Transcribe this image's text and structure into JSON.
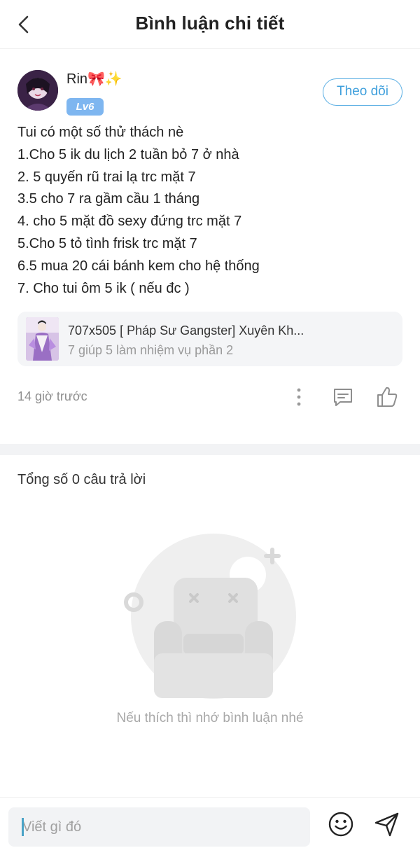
{
  "header": {
    "title": "Bình luận chi tiết",
    "back_icon": "chevron-left-icon"
  },
  "comment": {
    "user": {
      "name": "Rin🎀✨",
      "level": "Lv6"
    },
    "follow_label": "Theo dõi",
    "lines": [
      "Tui có một số thử thách nè",
      "1.Cho 5 ik du lịch 2 tuần bỏ 7 ở nhà",
      "2. 5 quyến rũ trai lạ trc mặt 7",
      "3.5 cho 7 ra gầm cầu 1 tháng",
      "4. cho 5 mặt đồ sexy đứng trc mặt 7",
      "5.Cho 5 tỏ tình frisk trc mặt 7",
      "6.5 mua 20 cái bánh kem cho hệ thống",
      "7. Cho tui ôm 5 ik ( nếu đc )"
    ],
    "novel": {
      "title": "707x505 [ Pháp Sư Gangster] Xuyên Kh...",
      "subtitle": "7 giúp 5 làm nhiệm vụ phần 2"
    },
    "time": "14 giờ trước",
    "actions": [
      "more-icon",
      "reply-icon",
      "like-icon"
    ]
  },
  "replies": {
    "count_label": "Tổng số 0 câu trả lời",
    "empty_text": "Nếu thích thì nhớ bình luận nhé"
  },
  "input": {
    "placeholder": "Viết gì đó",
    "emoji_icon": "emoji-icon",
    "send_icon": "send-icon"
  },
  "colors": {
    "accent": "#3e9fdc",
    "level_badge": "#7eb6f0",
    "muted_text": "#8e8e8e",
    "divider": "#f2f3f5"
  }
}
